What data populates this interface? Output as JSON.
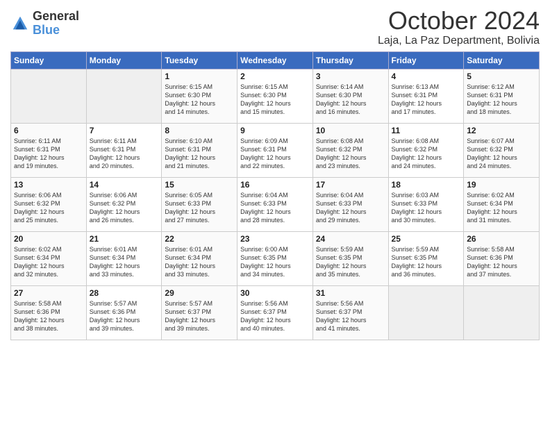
{
  "logo": {
    "general": "General",
    "blue": "Blue"
  },
  "title": "October 2024",
  "location": "Laja, La Paz Department, Bolivia",
  "days_of_week": [
    "Sunday",
    "Monday",
    "Tuesday",
    "Wednesday",
    "Thursday",
    "Friday",
    "Saturday"
  ],
  "weeks": [
    [
      {
        "day": "",
        "empty": true
      },
      {
        "day": "",
        "empty": true
      },
      {
        "day": "1",
        "sunrise": "6:15 AM",
        "sunset": "6:30 PM",
        "daylight": "12 hours and 14 minutes."
      },
      {
        "day": "2",
        "sunrise": "6:15 AM",
        "sunset": "6:30 PM",
        "daylight": "12 hours and 15 minutes."
      },
      {
        "day": "3",
        "sunrise": "6:14 AM",
        "sunset": "6:30 PM",
        "daylight": "12 hours and 16 minutes."
      },
      {
        "day": "4",
        "sunrise": "6:13 AM",
        "sunset": "6:31 PM",
        "daylight": "12 hours and 17 minutes."
      },
      {
        "day": "5",
        "sunrise": "6:12 AM",
        "sunset": "6:31 PM",
        "daylight": "12 hours and 18 minutes."
      }
    ],
    [
      {
        "day": "6",
        "sunrise": "6:11 AM",
        "sunset": "6:31 PM",
        "daylight": "12 hours and 19 minutes."
      },
      {
        "day": "7",
        "sunrise": "6:11 AM",
        "sunset": "6:31 PM",
        "daylight": "12 hours and 20 minutes."
      },
      {
        "day": "8",
        "sunrise": "6:10 AM",
        "sunset": "6:31 PM",
        "daylight": "12 hours and 21 minutes."
      },
      {
        "day": "9",
        "sunrise": "6:09 AM",
        "sunset": "6:31 PM",
        "daylight": "12 hours and 22 minutes."
      },
      {
        "day": "10",
        "sunrise": "6:08 AM",
        "sunset": "6:32 PM",
        "daylight": "12 hours and 23 minutes."
      },
      {
        "day": "11",
        "sunrise": "6:08 AM",
        "sunset": "6:32 PM",
        "daylight": "12 hours and 24 minutes."
      },
      {
        "day": "12",
        "sunrise": "6:07 AM",
        "sunset": "6:32 PM",
        "daylight": "12 hours and 24 minutes."
      }
    ],
    [
      {
        "day": "13",
        "sunrise": "6:06 AM",
        "sunset": "6:32 PM",
        "daylight": "12 hours and 25 minutes."
      },
      {
        "day": "14",
        "sunrise": "6:06 AM",
        "sunset": "6:32 PM",
        "daylight": "12 hours and 26 minutes."
      },
      {
        "day": "15",
        "sunrise": "6:05 AM",
        "sunset": "6:33 PM",
        "daylight": "12 hours and 27 minutes."
      },
      {
        "day": "16",
        "sunrise": "6:04 AM",
        "sunset": "6:33 PM",
        "daylight": "12 hours and 28 minutes."
      },
      {
        "day": "17",
        "sunrise": "6:04 AM",
        "sunset": "6:33 PM",
        "daylight": "12 hours and 29 minutes."
      },
      {
        "day": "18",
        "sunrise": "6:03 AM",
        "sunset": "6:33 PM",
        "daylight": "12 hours and 30 minutes."
      },
      {
        "day": "19",
        "sunrise": "6:02 AM",
        "sunset": "6:34 PM",
        "daylight": "12 hours and 31 minutes."
      }
    ],
    [
      {
        "day": "20",
        "sunrise": "6:02 AM",
        "sunset": "6:34 PM",
        "daylight": "12 hours and 32 minutes."
      },
      {
        "day": "21",
        "sunrise": "6:01 AM",
        "sunset": "6:34 PM",
        "daylight": "12 hours and 33 minutes."
      },
      {
        "day": "22",
        "sunrise": "6:01 AM",
        "sunset": "6:34 PM",
        "daylight": "12 hours and 33 minutes."
      },
      {
        "day": "23",
        "sunrise": "6:00 AM",
        "sunset": "6:35 PM",
        "daylight": "12 hours and 34 minutes."
      },
      {
        "day": "24",
        "sunrise": "5:59 AM",
        "sunset": "6:35 PM",
        "daylight": "12 hours and 35 minutes."
      },
      {
        "day": "25",
        "sunrise": "5:59 AM",
        "sunset": "6:35 PM",
        "daylight": "12 hours and 36 minutes."
      },
      {
        "day": "26",
        "sunrise": "5:58 AM",
        "sunset": "6:36 PM",
        "daylight": "12 hours and 37 minutes."
      }
    ],
    [
      {
        "day": "27",
        "sunrise": "5:58 AM",
        "sunset": "6:36 PM",
        "daylight": "12 hours and 38 minutes."
      },
      {
        "day": "28",
        "sunrise": "5:57 AM",
        "sunset": "6:36 PM",
        "daylight": "12 hours and 39 minutes."
      },
      {
        "day": "29",
        "sunrise": "5:57 AM",
        "sunset": "6:37 PM",
        "daylight": "12 hours and 39 minutes."
      },
      {
        "day": "30",
        "sunrise": "5:56 AM",
        "sunset": "6:37 PM",
        "daylight": "12 hours and 40 minutes."
      },
      {
        "day": "31",
        "sunrise": "5:56 AM",
        "sunset": "6:37 PM",
        "daylight": "12 hours and 41 minutes."
      },
      {
        "day": "",
        "empty": true
      },
      {
        "day": "",
        "empty": true
      }
    ]
  ]
}
